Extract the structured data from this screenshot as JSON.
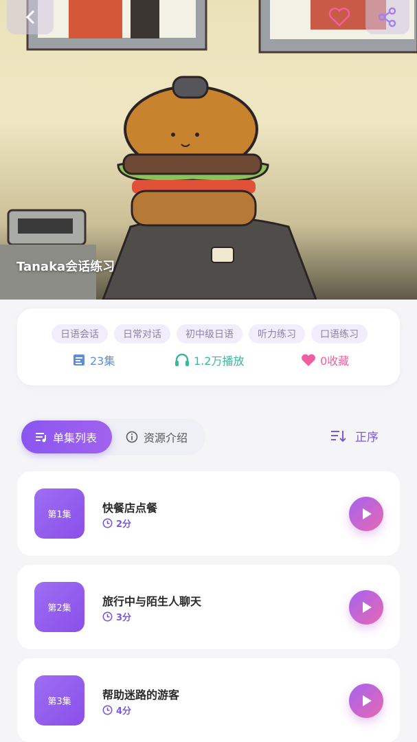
{
  "hero": {
    "title": "Tanaka会话练习"
  },
  "info": {
    "tags": [
      "日语会话",
      "日常对话",
      "初中级日语",
      "听力练习",
      "口语练习"
    ],
    "episodes": "23集",
    "plays": "1.2万播放",
    "favorites": "0收藏"
  },
  "tabs": {
    "list": "单集列表",
    "intro": "资源介绍"
  },
  "sort": {
    "label": "正序"
  },
  "episodes": [
    {
      "badge": "第1集",
      "title": "快餐店点餐",
      "duration": "2分"
    },
    {
      "badge": "第2集",
      "title": "旅行中与陌生人聊天",
      "duration": "3分"
    },
    {
      "badge": "第3集",
      "title": "帮助迷路的游客",
      "duration": "4分"
    }
  ],
  "colors": {
    "accent": "#8a55f0",
    "episodes_stat": "#5e8fd6",
    "plays_stat": "#3ab89b",
    "fav_stat": "#ee5fa0"
  },
  "icons": {
    "back": "chevron-left-icon",
    "favorite": "heart-icon",
    "share": "share-icon",
    "episodes": "list-icon",
    "plays": "headphones-icon",
    "fav": "heart-icon",
    "list_tab": "playlist-icon",
    "intro_tab": "info-icon",
    "sort": "sort-icon",
    "duration": "clock-icon",
    "play": "play-icon"
  }
}
